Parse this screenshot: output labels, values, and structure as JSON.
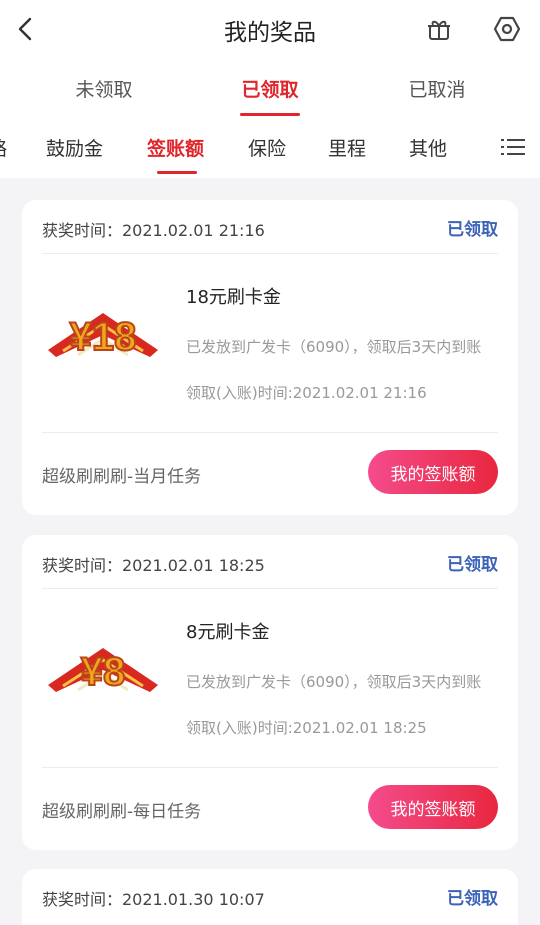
{
  "header": {
    "title": "我的奖品",
    "icons": {
      "back": "back-chevron-icon",
      "gift": "gift-icon",
      "settings": "hexagon-settings-icon"
    }
  },
  "status_tabs": [
    {
      "label": "未领取",
      "active": false
    },
    {
      "label": "已领取",
      "active": true
    },
    {
      "label": "已取消",
      "active": false
    }
  ],
  "category_tabs": [
    {
      "label": "略",
      "active": false
    },
    {
      "label": "鼓励金",
      "active": false
    },
    {
      "label": "签账额",
      "active": true
    },
    {
      "label": "保险",
      "active": false
    },
    {
      "label": "里程",
      "active": false
    },
    {
      "label": "其他",
      "active": false
    }
  ],
  "cards": [
    {
      "time": "获奖时间：2021.02.01 21:16",
      "status": "已领取",
      "prize_badge": "¥18",
      "prize_name": "18元刷卡金",
      "desc": "已发放到广发卡（6090），领取后3天内到账",
      "claim_time": "领取(入账)时间:2021.02.01 21:16",
      "source": "超级刷刷刷-当月任务",
      "button": "我的签账额"
    },
    {
      "time": "获奖时间：2021.02.01 18:25",
      "status": "已领取",
      "prize_badge": "¥8",
      "prize_name": "8元刷卡金",
      "desc": "已发放到广发卡（6090），领取后3天内到账",
      "claim_time": "领取(入账)时间:2021.02.01 18:25",
      "source": "超级刷刷刷-每日任务",
      "button": "我的签账额"
    },
    {
      "time": "获奖时间：2021.01.30 10:07",
      "status": "已领取"
    }
  ],
  "colors": {
    "accent": "#e0262d",
    "claimed": "#3d63b8",
    "button_start": "#f44c8c",
    "button_end": "#e8273f"
  }
}
